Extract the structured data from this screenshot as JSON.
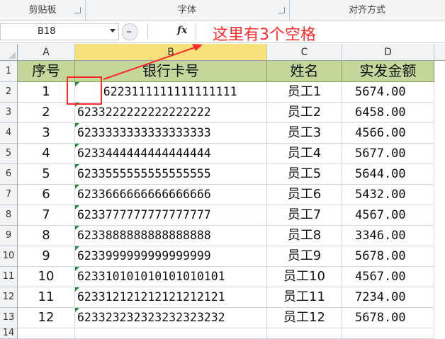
{
  "ribbon": {
    "groups": [
      "剪贴板",
      "字体",
      "对齐方式"
    ]
  },
  "formula_bar": {
    "name_box": "B18",
    "fx_label": "fx",
    "formula_value": ""
  },
  "annotation": {
    "text": "这里有3个空格",
    "color": "#ff2b2b"
  },
  "grid": {
    "columns": [
      "A",
      "B",
      "C",
      "D"
    ],
    "selected_column": "B",
    "header_row": [
      "序号",
      "银行卡号",
      "姓名",
      "实发金额"
    ],
    "header_fill": "#c4d79b",
    "rows": [
      {
        "row": "2",
        "seq": "1",
        "card": "   6223111111111111111",
        "name": "员工1",
        "amount": "5674.00"
      },
      {
        "row": "3",
        "seq": "2",
        "card": "6233222222222222222",
        "name": "员工2",
        "amount": "6458.00"
      },
      {
        "row": "4",
        "seq": "3",
        "card": "6233333333333333333",
        "name": "员工3",
        "amount": "4566.00"
      },
      {
        "row": "5",
        "seq": "4",
        "card": "6233444444444444444",
        "name": "员工4",
        "amount": "5677.00"
      },
      {
        "row": "6",
        "seq": "5",
        "card": "6233555555555555555",
        "name": "员工5",
        "amount": "5644.00"
      },
      {
        "row": "7",
        "seq": "6",
        "card": "6233666666666666666",
        "name": "员工6",
        "amount": "5432.00"
      },
      {
        "row": "8",
        "seq": "7",
        "card": "6233777777777777777",
        "name": "员工7",
        "amount": "4567.00"
      },
      {
        "row": "9",
        "seq": "8",
        "card": "6233888888888888888",
        "name": "员工8",
        "amount": "3346.00"
      },
      {
        "row": "10",
        "seq": "9",
        "card": "6233999999999999999",
        "name": "员工9",
        "amount": "5678.00"
      },
      {
        "row": "11",
        "seq": "10",
        "card": "623310101010101010101",
        "name": "员工10",
        "amount": "4567.00"
      },
      {
        "row": "12",
        "seq": "11",
        "card": "623312121212121212121",
        "name": "员工11",
        "amount": "7234.00"
      },
      {
        "row": "13",
        "seq": "12",
        "card": "623323232323232323232",
        "name": "员工12",
        "amount": "5678.00"
      }
    ],
    "row_headers": [
      "1",
      "2",
      "3",
      "4",
      "5",
      "6",
      "7",
      "8",
      "9",
      "10",
      "11",
      "12",
      "13",
      "14"
    ]
  }
}
